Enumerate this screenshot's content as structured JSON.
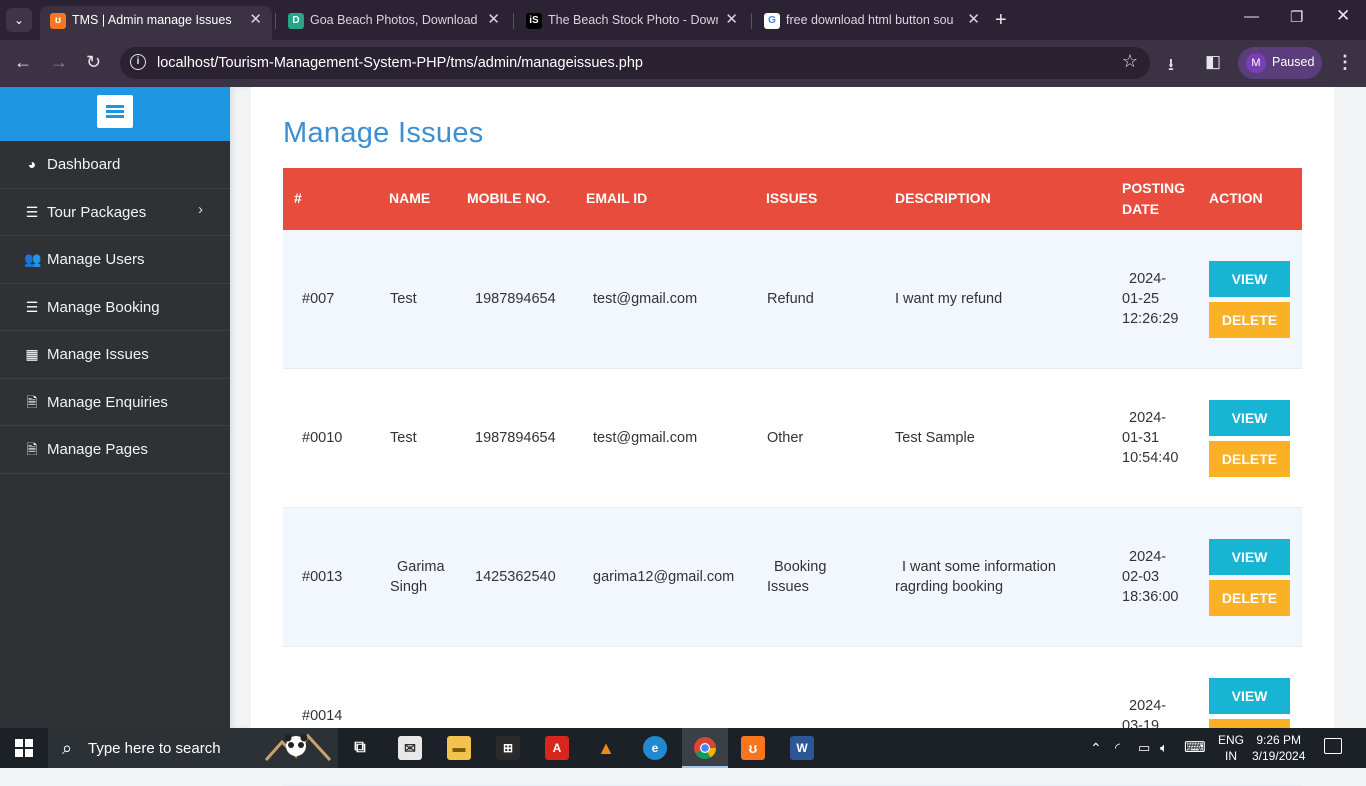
{
  "browser": {
    "tabs": [
      {
        "title": "TMS | Admin manage Issues",
        "fav": "xampp-icon",
        "fav_text": "ʊ",
        "fav_color": "#f87620"
      },
      {
        "title": "Goa Beach Photos, Download Th",
        "fav": "dreamstime-icon",
        "fav_text": "D",
        "fav_color": "#27a589"
      },
      {
        "title": "The Beach Stock Photo - Downlo",
        "fav": "istock-icon",
        "fav_text": "iS",
        "fav_color": "#000000"
      },
      {
        "title": "free download html button sou",
        "fav": "google-icon",
        "fav_text": "G",
        "fav_color": "#ffffff"
      }
    ],
    "url": "localhost/Tourism-Management-System-PHP/tms/admin/manageissues.php",
    "profile_initial": "M",
    "profile_label": "Paused"
  },
  "sidebar": {
    "items": [
      {
        "label": "Dashboard",
        "icon": "dashboard-icon",
        "glyph": "◕"
      },
      {
        "label": "Tour Packages",
        "icon": "list-icon",
        "glyph": "☰",
        "has_submenu": true
      },
      {
        "label": "Manage Users",
        "icon": "users-icon",
        "glyph": "👥"
      },
      {
        "label": "Manage Booking",
        "icon": "list-icon",
        "glyph": "☰"
      },
      {
        "label": "Manage Issues",
        "icon": "table-icon",
        "glyph": "▦"
      },
      {
        "label": "Manage Enquiries",
        "icon": "file-icon",
        "glyph": "🗎"
      },
      {
        "label": "Manage Pages",
        "icon": "file-icon",
        "glyph": "🗎"
      }
    ]
  },
  "page": {
    "title": "Manage Issues",
    "table": {
      "headers": [
        "#",
        "NAME",
        "MOBILE NO.",
        "EMAIL ID",
        "ISSUES",
        "DESCRIPTION",
        "POSTING DATE",
        "ACTION"
      ],
      "view_label": "VIEW",
      "delete_label": "DELETE",
      "rows": [
        {
          "id": "#007",
          "name": "Test",
          "mobile": "1987894654",
          "email": "test@gmail.com",
          "issue": "Refund",
          "description": "I want my refund",
          "date": "2024-\n01-25\n12:26:29"
        },
        {
          "id": "#0010",
          "name": "Test",
          "mobile": "1987894654",
          "email": "test@gmail.com",
          "issue": "Other",
          "description": "Test Sample",
          "date": "2024-\n01-31\n10:54:40"
        },
        {
          "id": "#0013",
          "name": "Garima\nSingh",
          "mobile": "1425362540",
          "email": "garima12@gmail.com",
          "issue": "Booking\nIssues",
          "description": "I want some information\nragrding booking",
          "date": "2024-\n02-03\n18:36:00"
        },
        {
          "id": "#0014",
          "name": "",
          "mobile": "",
          "email": "",
          "issue": "",
          "description": "",
          "date": "2024-\n03-19"
        }
      ]
    }
  },
  "taskbar": {
    "search_placeholder": "Type here to search",
    "lang_top": "ENG",
    "lang_bottom": "IN",
    "time": "9:26 PM",
    "date": "3/19/2024"
  }
}
